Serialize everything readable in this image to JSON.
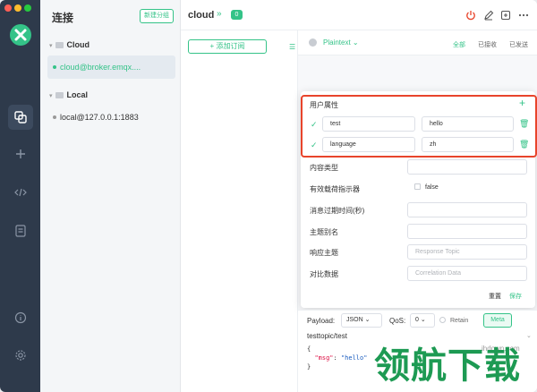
{
  "app": {
    "accent": "#34c388",
    "rail": {
      "traffic_lights": [
        "close",
        "minimize",
        "zoom"
      ],
      "icons": [
        "app-logo-icon",
        "connections-icon",
        "add-icon",
        "code-icon",
        "log-icon",
        "info-icon",
        "settings-icon"
      ]
    }
  },
  "connections": {
    "title": "连接",
    "new_group_label": "新建分组",
    "groups": [
      {
        "name": "Cloud",
        "items": [
          {
            "label": "cloud@broker.emqx....",
            "active": true
          }
        ]
      },
      {
        "name": "Local",
        "items": [
          {
            "label": "local@127.0.0.1:1883",
            "active": false
          }
        ]
      }
    ]
  },
  "header": {
    "connection_name": "cloud",
    "count_badge": "0"
  },
  "subscriptions": {
    "add_label": "+ 添加订阅"
  },
  "messages": {
    "format": "Plaintext",
    "filters": [
      {
        "label": "全部",
        "active": true
      },
      {
        "label": "已接收",
        "active": false
      },
      {
        "label": "已发送",
        "active": false
      }
    ]
  },
  "meta_popover": {
    "user_properties_title": "用户属性",
    "user_properties": [
      {
        "key": "test",
        "value": "hello"
      },
      {
        "key": "language",
        "value": "zh"
      }
    ],
    "content_type_label": "内容类型",
    "payload_indicator_label": "有效载荷指示器",
    "payload_indicator_value": "false",
    "expiry_label": "消息过期时间(秒)",
    "topic_alias_label": "主题别名",
    "response_topic_label": "响应主题",
    "response_topic_placeholder": "Response Topic",
    "correlation_label": "对比数据",
    "correlation_placeholder": "Correlation Data",
    "reset_label": "重置",
    "save_label": "保存"
  },
  "composer": {
    "payload_label": "Payload:",
    "payload_format": "JSON",
    "qos_label": "QoS:",
    "qos_value": "0",
    "retain_label": "Retain",
    "meta_label": "Meta",
    "topic": "testtopic/test",
    "payload_line1": "{",
    "payload_key": "\"msg\"",
    "payload_sep": ": ",
    "payload_val": "\"hello\"",
    "payload_line3": "}"
  },
  "watermark": {
    "big": "领航下载",
    "small": "ihdown.com"
  }
}
